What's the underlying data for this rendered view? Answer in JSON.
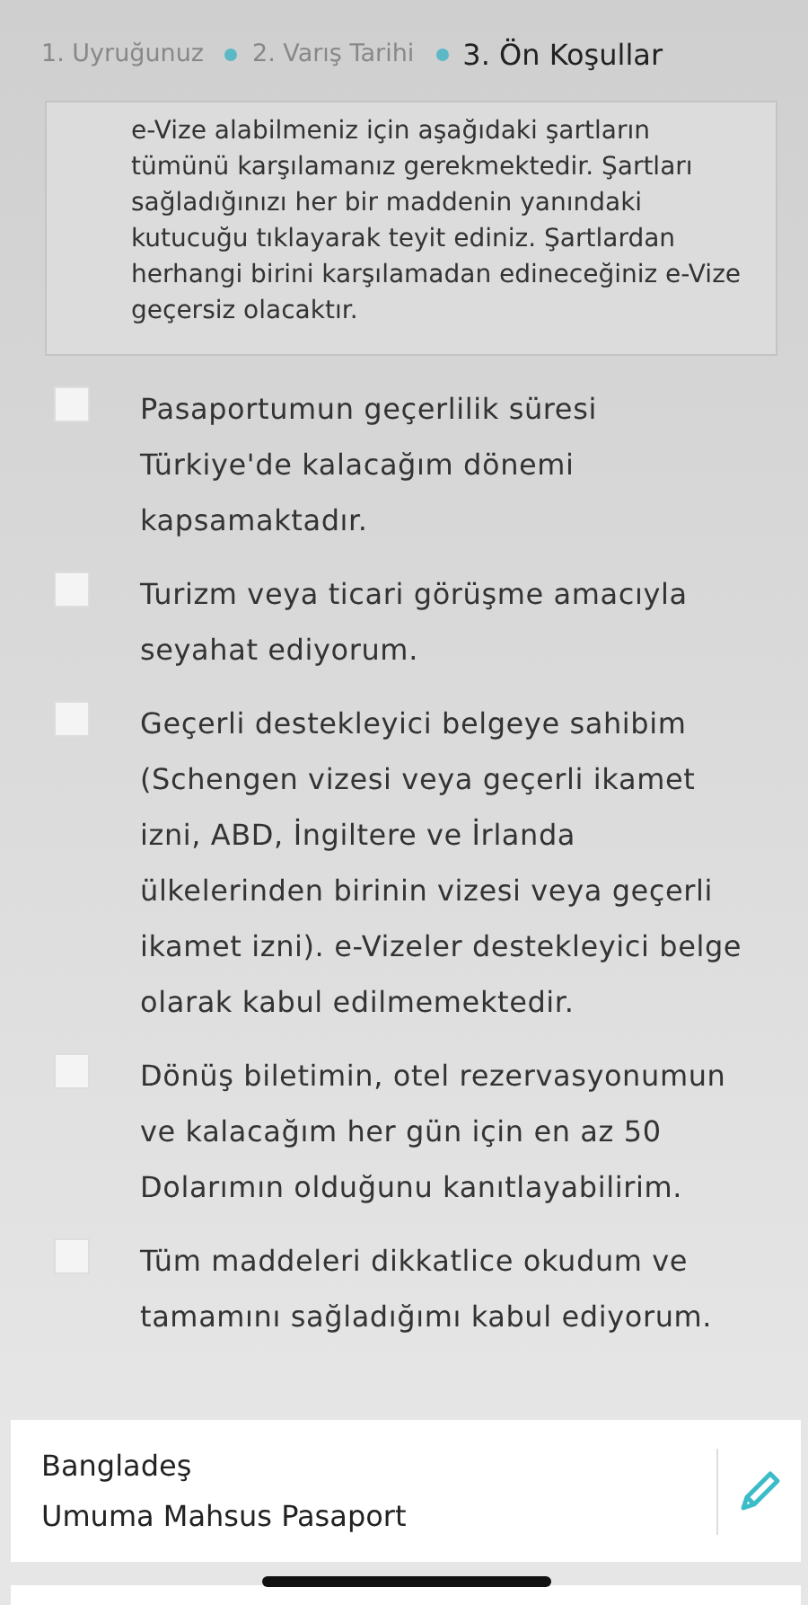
{
  "steps": [
    {
      "label": "1. Uyruğunuz",
      "selected": false
    },
    {
      "label": "2. Varış Tarihi",
      "selected": false
    },
    {
      "label": "3. Ön Koşullar",
      "selected": true
    }
  ],
  "notice": "e-Vize alabilmeniz için aşağıdaki şartların tümünü karşılamanız gerekmektedir. Şartları sağladığınızı her bir maddenin yanındaki kutucuğu tıklayarak teyit ediniz. Şartlardan herhangi birini karşılamadan edineceğiniz e-Vize geçersiz olacaktır.",
  "conditions": [
    {
      "text": "Pasaportumun geçerlilik süresi Türkiye'de kalacağım dönemi kapsamaktadır.",
      "checked": false
    },
    {
      "text": "Turizm veya ticari görüşme amacıyla seyahat ediyorum.",
      "checked": false
    },
    {
      "text": "Geçerli destekleyici belgeye sahibim (Schengen vizesi veya geçerli ikamet izni, ABD, İngiltere ve İrlanda ülkelerinden birinin vizesi veya geçerli ikamet izni). e-Vizeler destekleyici belge olarak kabul edilmemektedir.",
      "checked": false
    },
    {
      "text": "Dönüş biletimin, otel rezervasyonumun ve kalacağım her gün için en az 50 Dolarımın olduğunu kanıtlayabilirim.",
      "checked": false
    },
    {
      "text": "Tüm maddeleri dikkatlice okudum ve tamamını sağladığımı kabul ediyorum.",
      "checked": false
    }
  ],
  "summary": {
    "country": "Bangladeş",
    "passport_type": "Umuma Mahsus Pasaport"
  }
}
